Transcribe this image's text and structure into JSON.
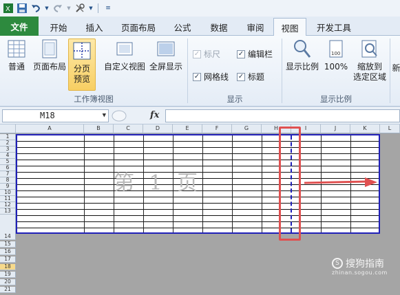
{
  "quick_access": {
    "save_icon": "save-icon",
    "undo_icon": "undo-icon",
    "redo_icon": "redo-icon",
    "tools_icon": "tools-icon",
    "customize_icon": "customize-qat-icon"
  },
  "tabs": [
    {
      "label": "文件"
    },
    {
      "label": "开始"
    },
    {
      "label": "插入"
    },
    {
      "label": "页面布局"
    },
    {
      "label": "公式"
    },
    {
      "label": "数据"
    },
    {
      "label": "审阅"
    },
    {
      "label": "视图"
    },
    {
      "label": "开发工具"
    }
  ],
  "ribbon": {
    "workbook_views": {
      "label": "工作簿视图",
      "normal": "普通",
      "page_layout": "页面布局",
      "page_break_line1": "分页",
      "page_break_line2": "预览",
      "custom_views": "自定义视图",
      "full_screen": "全屏显示"
    },
    "show": {
      "label": "显示",
      "ruler": "标尺",
      "formula_bar": "编辑栏",
      "gridlines": "网格线",
      "headings": "标题"
    },
    "zoom": {
      "label": "显示比例",
      "zoom": "显示比例",
      "hundred": "100%",
      "to_selection_line1": "缩放到",
      "to_selection_line2": "选定区域",
      "new_window_partial": "新"
    }
  },
  "formula_bar": {
    "name_box": "M18",
    "fx": "fx",
    "formula": ""
  },
  "grid": {
    "columns": [
      "A",
      "B",
      "C",
      "D",
      "E",
      "F",
      "G",
      "H",
      "I",
      "J",
      "K",
      "L"
    ],
    "rows": [
      "1",
      "2",
      "3",
      "4",
      "5",
      "6",
      "7",
      "8",
      "9",
      "10",
      "11",
      "12",
      "13",
      "14",
      "15",
      "16",
      "17",
      "18",
      "19",
      "20",
      "21"
    ],
    "selected_row": "18",
    "page_watermark": "第 1 页"
  },
  "watermark": {
    "brand": "搜狗指南",
    "site": "zhinan.sogou.com"
  },
  "colors": {
    "file_tab": "#2d8a3e",
    "page_border": "#1f1fb8",
    "highlight_box": "#e05050",
    "selected_button": "#f8cf63"
  }
}
